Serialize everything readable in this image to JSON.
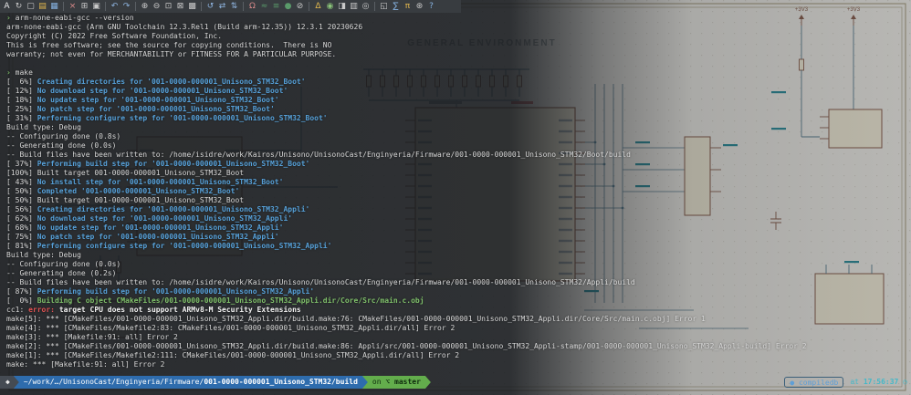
{
  "toolbar": {
    "icons": [
      {
        "n": "text-label-icon",
        "g": "A",
        "c": "#e6e6e6"
      },
      {
        "n": "refresh-icon",
        "g": "↻",
        "c": "#c9c9c9"
      },
      {
        "n": "new-schematic-icon",
        "g": "▢",
        "c": "#c9c9c9"
      },
      {
        "n": "open-icon",
        "g": "▤",
        "c": "#e2b84e"
      },
      {
        "n": "save-icon",
        "g": "▦",
        "c": "#86b2e0"
      },
      {
        "sep": true
      },
      {
        "n": "cut-icon",
        "g": "×",
        "c": "#d88a8a"
      },
      {
        "n": "copy-icon",
        "g": "⊞",
        "c": "#c9c9c9"
      },
      {
        "n": "paste-icon",
        "g": "▣",
        "c": "#c9c9c9"
      },
      {
        "sep": true
      },
      {
        "n": "undo-icon",
        "g": "↶",
        "c": "#8fb5e0"
      },
      {
        "n": "redo-icon",
        "g": "↷",
        "c": "#8fb5e0"
      },
      {
        "sep": true
      },
      {
        "n": "zoom-in-icon",
        "g": "⊕",
        "c": "#c9c9c9"
      },
      {
        "n": "zoom-out-icon",
        "g": "⊖",
        "c": "#c9c9c9"
      },
      {
        "n": "zoom-fit-icon",
        "g": "⊡",
        "c": "#c9c9c9"
      },
      {
        "n": "zoom-selection-icon",
        "g": "⊠",
        "c": "#c9c9c9"
      },
      {
        "n": "grid-icon",
        "g": "▩",
        "c": "#c9c9c9"
      },
      {
        "sep": true
      },
      {
        "n": "rotate-icon",
        "g": "↺",
        "c": "#8fb5e0"
      },
      {
        "n": "mirror-horizontal-icon",
        "g": "⇄",
        "c": "#8fb5e0"
      },
      {
        "n": "mirror-vertical-icon",
        "g": "⇅",
        "c": "#8fb5e0"
      },
      {
        "sep": true
      },
      {
        "n": "add-symbol-icon",
        "g": "Ω",
        "c": "#d88a8a"
      },
      {
        "n": "add-wire-icon",
        "g": "≈",
        "c": "#5a9a6a"
      },
      {
        "n": "add-bus-icon",
        "g": "≡",
        "c": "#5a9a6a"
      },
      {
        "n": "add-junction-icon",
        "g": "●",
        "c": "#5a9a6a"
      },
      {
        "n": "no-connect-icon",
        "g": "⊘",
        "c": "#c9c9c9"
      },
      {
        "sep": true
      },
      {
        "n": "annotate-icon",
        "g": "Δ",
        "c": "#e2b84e"
      },
      {
        "n": "erc-check-icon",
        "g": "◉",
        "c": "#8ac379"
      },
      {
        "n": "plot-icon",
        "g": "◨",
        "c": "#c9c9c9"
      },
      {
        "n": "print-icon",
        "g": "▥",
        "c": "#c9c9c9"
      },
      {
        "n": "find-icon",
        "g": "◎",
        "c": "#c9c9c9"
      },
      {
        "sep": true
      },
      {
        "n": "hierarchy-sheet-icon",
        "g": "◱",
        "c": "#c9c9c9"
      },
      {
        "n": "simulator-icon",
        "g": "∑",
        "c": "#86b2e0"
      },
      {
        "n": "scripting-icon",
        "g": "π",
        "c": "#e2b84e"
      },
      {
        "n": "settings-icon",
        "g": "⊛",
        "c": "#c9c9c9"
      },
      {
        "n": "help-icon",
        "g": "?",
        "c": "#86b2e0"
      }
    ]
  },
  "terminal": {
    "lines": [
      {
        "segs": [
          {
            "t": "› ",
            "c": "prompt"
          },
          {
            "t": "arm-none-eabi-gcc --version",
            "c": "fg"
          }
        ]
      },
      {
        "segs": [
          {
            "t": "arm-none-eabi-gcc (Arm GNU Toolchain 12.3.Rel1 (Build arm-12.35)) 12.3.1 20230626",
            "c": "fg"
          }
        ]
      },
      {
        "segs": [
          {
            "t": "Copyright (C) 2022 Free Software Foundation, Inc.",
            "c": "fg"
          }
        ]
      },
      {
        "segs": [
          {
            "t": "This is free software; see the source for copying conditions.  There is NO",
            "c": "fg"
          }
        ]
      },
      {
        "segs": [
          {
            "t": "warranty; not even for MERCHANTABILITY or FITNESS FOR A PARTICULAR PURPOSE.",
            "c": "fg"
          }
        ]
      },
      {
        "segs": []
      },
      {
        "segs": [
          {
            "t": "› ",
            "c": "prompt"
          },
          {
            "t": "make",
            "c": "fg"
          }
        ]
      },
      {
        "segs": [
          {
            "t": "[  6%] ",
            "c": "fg"
          },
          {
            "t": "Creating directories for '001-0000-000001_Unisono_STM32_Boot'",
            "c": "blue"
          }
        ]
      },
      {
        "segs": [
          {
            "t": "[ 12%] ",
            "c": "fg"
          },
          {
            "t": "No download step for '001-0000-000001_Unisono_STM32_Boot'",
            "c": "blue"
          }
        ]
      },
      {
        "segs": [
          {
            "t": "[ 18%] ",
            "c": "fg"
          },
          {
            "t": "No update step for '001-0000-000001_Unisono_STM32_Boot'",
            "c": "blue"
          }
        ]
      },
      {
        "segs": [
          {
            "t": "[ 25%] ",
            "c": "fg"
          },
          {
            "t": "No patch step for '001-0000-000001_Unisono_STM32_Boot'",
            "c": "blue"
          }
        ]
      },
      {
        "segs": [
          {
            "t": "[ 31%] ",
            "c": "fg"
          },
          {
            "t": "Performing configure step for '001-0000-000001_Unisono_STM32_Boot'",
            "c": "blue"
          }
        ]
      },
      {
        "segs": [
          {
            "t": "Build type: Debug",
            "c": "fg"
          }
        ]
      },
      {
        "segs": [
          {
            "t": "-- Configuring done (0.8s)",
            "c": "fg"
          }
        ]
      },
      {
        "segs": [
          {
            "t": "-- Generating done (0.0s)",
            "c": "fg"
          }
        ]
      },
      {
        "segs": [
          {
            "t": "-- Build files have been written to: /home/isidre/work/Kairos/Unisono/UnisonoCast/Enginyeria/Firmware/001-0000-000001_Unisono_STM32/Boot/build",
            "c": "fg"
          }
        ]
      },
      {
        "segs": [
          {
            "t": "[ 37%] ",
            "c": "fg"
          },
          {
            "t": "Performing build step for '001-0000-000001_Unisono_STM32_Boot'",
            "c": "blue"
          }
        ]
      },
      {
        "segs": [
          {
            "t": "[100%] Built target 001-0000-000001_Unisono_STM32_Boot",
            "c": "fg"
          }
        ]
      },
      {
        "segs": [
          {
            "t": "[ 43%] ",
            "c": "fg"
          },
          {
            "t": "No install step for '001-0000-000001_Unisono_STM32_Boot'",
            "c": "blue"
          }
        ]
      },
      {
        "segs": [
          {
            "t": "[ 50%] ",
            "c": "fg"
          },
          {
            "t": "Completed '001-0000-000001_Unisono_STM32_Boot'",
            "c": "blue"
          }
        ]
      },
      {
        "segs": [
          {
            "t": "[ 50%] Built target 001-0000-000001_Unisono_STM32_Boot",
            "c": "fg"
          }
        ]
      },
      {
        "segs": [
          {
            "t": "[ 56%] ",
            "c": "fg"
          },
          {
            "t": "Creating directories for '001-0000-000001_Unisono_STM32_Appli'",
            "c": "blue"
          }
        ]
      },
      {
        "segs": [
          {
            "t": "[ 62%] ",
            "c": "fg"
          },
          {
            "t": "No download step for '001-0000-000001_Unisono_STM32_Appli'",
            "c": "blue"
          }
        ]
      },
      {
        "segs": [
          {
            "t": "[ 68%] ",
            "c": "fg"
          },
          {
            "t": "No update step for '001-0000-000001_Unisono_STM32_Appli'",
            "c": "blue"
          }
        ]
      },
      {
        "segs": [
          {
            "t": "[ 75%] ",
            "c": "fg"
          },
          {
            "t": "No patch step for '001-0000-000001_Unisono_STM32_Appli'",
            "c": "blue"
          }
        ]
      },
      {
        "segs": [
          {
            "t": "[ 81%] ",
            "c": "fg"
          },
          {
            "t": "Performing configure step for '001-0000-000001_Unisono_STM32_Appli'",
            "c": "blue"
          }
        ]
      },
      {
        "segs": [
          {
            "t": "Build type: Debug",
            "c": "fg"
          }
        ]
      },
      {
        "segs": [
          {
            "t": "-- Configuring done (0.0s)",
            "c": "fg"
          }
        ]
      },
      {
        "segs": [
          {
            "t": "-- Generating done (0.2s)",
            "c": "fg"
          }
        ]
      },
      {
        "segs": [
          {
            "t": "-- Build files have been written to: /home/isidre/work/Kairos/Unisono/UnisonoCast/Enginyeria/Firmware/001-0000-000001_Unisono_STM32/Appli/build",
            "c": "fg"
          }
        ]
      },
      {
        "segs": [
          {
            "t": "[ 87%] ",
            "c": "fg"
          },
          {
            "t": "Performing build step for '001-0000-000001_Unisono_STM32_Appli'",
            "c": "blue"
          }
        ]
      },
      {
        "segs": [
          {
            "t": "[  0%] ",
            "c": "fg"
          },
          {
            "t": "Building C object CMakeFiles/001-0000-000001_Unisono_STM32_Appli.dir/Core/Src/main.c.obj",
            "c": "green"
          }
        ]
      },
      {
        "segs": [
          {
            "t": "cc1: ",
            "c": "fg"
          },
          {
            "t": "error: ",
            "c": "red"
          },
          {
            "t": "target CPU does not support ARMv8-M Security Extensions",
            "c": "fgb"
          }
        ]
      },
      {
        "segs": [
          {
            "t": "make[5]: *** [CMakeFiles/001-0000-000001_Unisono_STM32_Appli.dir/build.make:76: CMakeFiles/001-0000-000001_Unisono_STM32_Appli.dir/Core/Src/main.c.obj] Error 1",
            "c": "fg"
          }
        ]
      },
      {
        "segs": [
          {
            "t": "make[4]: *** [CMakeFiles/Makefile2:83: CMakeFiles/001-0000-000001_Unisono_STM32_Appli.dir/all] Error 2",
            "c": "fg"
          }
        ]
      },
      {
        "segs": [
          {
            "t": "make[3]: *** [Makefile:91: all] Error 2",
            "c": "fg"
          }
        ]
      },
      {
        "segs": [
          {
            "t": "make[2]: *** [CMakeFiles/001-0000-000001_Unisono_STM32_Appli.dir/build.make:86: Appli/src/001-0000-000001_Unisono_STM32_Appli-stamp/001-0000-000001_Unisono_STM32_Appli-build] Error 2",
            "c": "fg"
          }
        ]
      },
      {
        "segs": [
          {
            "t": "make[1]: *** [CMakeFiles/Makefile2:111: CMakeFiles/001-0000-000001_Unisono_STM32_Appli.dir/all] Error 2",
            "c": "fg"
          }
        ]
      },
      {
        "segs": [
          {
            "t": "make: *** [Makefile:91: all] Error 2",
            "c": "fg"
          }
        ]
      }
    ]
  },
  "prompt": {
    "os_icon": "◆",
    "path_head": "~/work/…/UnisonoCast/Enginyeria/Firmware/",
    "path_tail": "001-0000-000001_Unisono_STM32/build",
    "git_prefix": "on",
    "git_icon": "⌥",
    "git_branch": "master",
    "tool_icon": "●",
    "tool_label": "compiledb",
    "time_label": "at",
    "time_value": "17:56:37",
    "clock_icon": "◷"
  },
  "schematic": {
    "title": "GENERAL ENVIRONMENT",
    "power1": "+3V3",
    "power2": "+3V3",
    "accent_colors": {
      "wire": "#5b7f91",
      "symbol": "#8a5f4e",
      "net_label": "#2f8f9c",
      "background": "#f1efe9"
    }
  }
}
